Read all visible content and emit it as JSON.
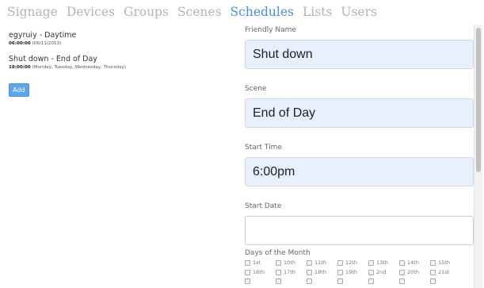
{
  "nav": {
    "items": [
      "Signage",
      "Devices",
      "Groups",
      "Scenes",
      "Schedules",
      "Lists",
      "Users"
    ],
    "active_index": 4
  },
  "schedules": [
    {
      "name": "egyruiy - Daytime",
      "time": "06:00:00",
      "detail": "(06/11/2013)"
    },
    {
      "name": "Shut down - End of Day",
      "time": "18:00:00",
      "detail": "(Monday, Tuesday, Wednesday, Thursday)"
    }
  ],
  "add_label": "Add",
  "form": {
    "friendly_name": {
      "label": "Friendly Name",
      "value": "Shut down"
    },
    "scene": {
      "label": "Scene",
      "value": "End of Day"
    },
    "start_time": {
      "label": "Start Time",
      "value": "6:00pm"
    },
    "start_date": {
      "label": "Start Date",
      "value": ""
    }
  },
  "days_of_month": {
    "label": "Days of the Month",
    "days": [
      "1st",
      "10th",
      "11th",
      "12th",
      "13th",
      "14th",
      "15th",
      "16th",
      "17th",
      "18th",
      "19th",
      "2nd",
      "20th",
      "21st",
      "",
      "",
      "",
      "",
      "",
      "",
      ""
    ]
  }
}
